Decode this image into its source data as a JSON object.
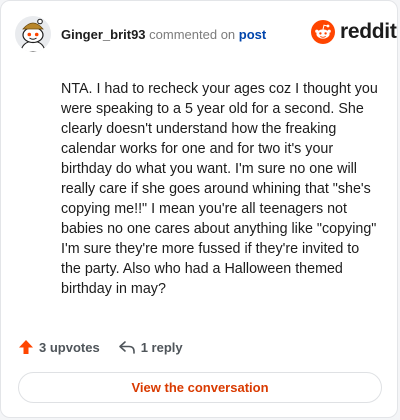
{
  "header": {
    "username": "Ginger_brit93",
    "action_text": "commented on",
    "post_link": "post"
  },
  "logo": {
    "wordmark": "reddit",
    "icon": "reddit-snoo-icon",
    "color": "#ff4500"
  },
  "comment": {
    "body": "NTA. I had to recheck your ages coz I thought you were speaking to a 5 year old for a second. She clearly doesn't understand how the freaking calendar works for one and for two it's your birthday do what you want. I'm sure no one will really care if she goes around whining that \"she's copying me!!\" I mean you're all teenagers not babies no one cares about anything like \"copying\" I'm sure they're more fussed if they're invited to the party. Also who had a Halloween themed birthday in may?"
  },
  "stats": {
    "upvotes": "3 upvotes",
    "upvote_icon": "upvote-arrow-icon",
    "upvote_color": "#ff4500",
    "replies": "1 reply",
    "reply_icon": "reply-arrow-icon"
  },
  "cta": {
    "label": "View the conversation",
    "color": "#d93a00"
  }
}
